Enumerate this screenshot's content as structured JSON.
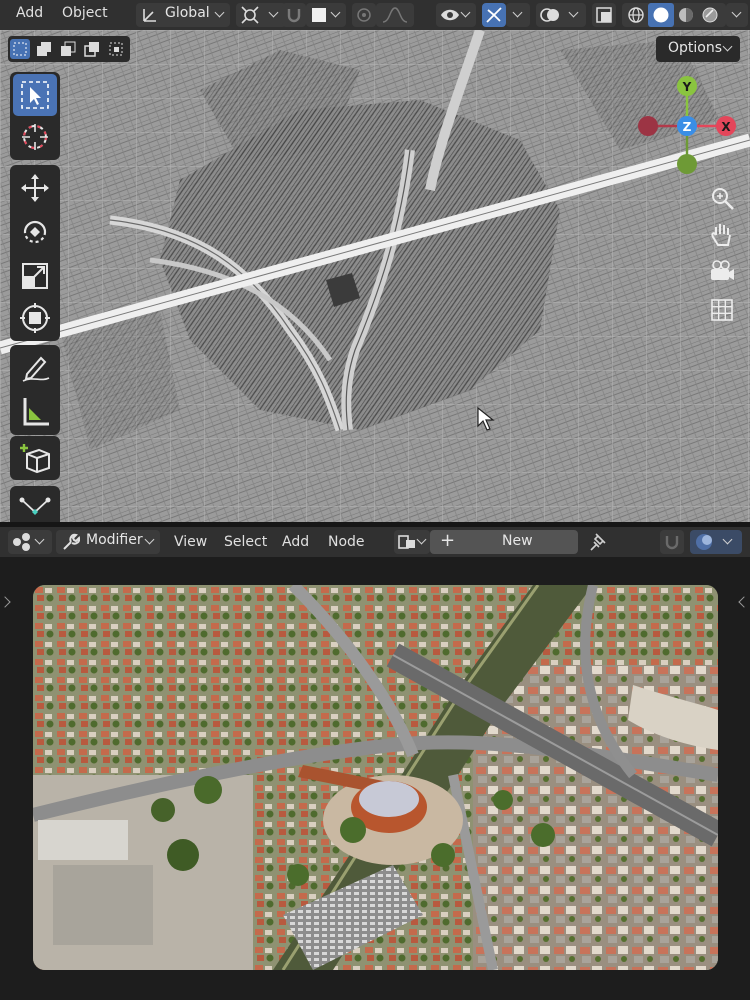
{
  "header": {
    "menu": [
      "Add",
      "Object"
    ],
    "orientation": "Global",
    "options_label": "Options"
  },
  "gizmo": {
    "y": "Y",
    "z": "Z",
    "x": "X"
  },
  "node_header": {
    "editor_type": "Modifier",
    "menu": [
      "View",
      "Select",
      "Add",
      "Node"
    ],
    "new_label": "New",
    "plus": "+"
  },
  "colors": {
    "accent_blue": "#4772b3",
    "axis_x": "#e4465a",
    "axis_y": "#8ac43f",
    "axis_z": "#3a8ee6",
    "panel_bg": "#303030"
  },
  "icons": {
    "viewport_tools": [
      "select-box-icon",
      "cursor-icon",
      "move-icon",
      "rotate-icon",
      "scale-icon",
      "transform-icon",
      "annotate-icon",
      "measure-icon",
      "add-cube-icon",
      "knife-curve-icon"
    ],
    "nav": [
      "zoom-icon",
      "pan-hand-icon",
      "camera-icon",
      "grid-ortho-icon"
    ]
  }
}
